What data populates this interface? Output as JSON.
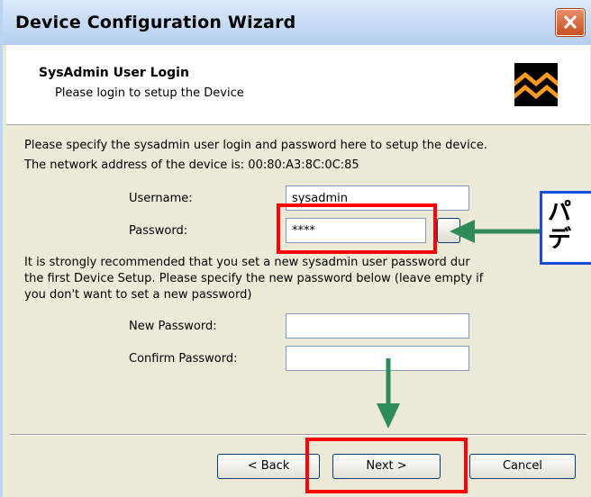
{
  "window": {
    "title": "Device Configuration Wizard"
  },
  "header": {
    "title": "SysAdmin User Login",
    "subtitle": "Please login to setup the Device"
  },
  "intro": {
    "line1": "Please specify the sysadmin user login and password here to setup the device.",
    "line2": "The network address of the device is:  00:80:A3:8C:0C:85"
  },
  "login": {
    "username_label": "Username:",
    "username_value": "sysadmin",
    "password_label": "Password:",
    "password_value": "****"
  },
  "recommend": {
    "line1": "It is strongly recommended that you set a new sysadmin user password dur",
    "line2": "the first Device Setup. Please specify the new password below (leave empty if",
    "line3": "you don't want to set a new password)"
  },
  "new_password": {
    "new_label": "New Password:",
    "new_value": "",
    "confirm_label": "Confirm Password:",
    "confirm_value": ""
  },
  "buttons": {
    "back": "< Back",
    "next": "Next >",
    "cancel": "Cancel"
  },
  "annotation": {
    "text_line1": "パ",
    "text_line2": "デ",
    "highlight_color": "#ff0000",
    "arrow_color": "#2e8b57",
    "callout_border_color": "#1a4bdc"
  }
}
